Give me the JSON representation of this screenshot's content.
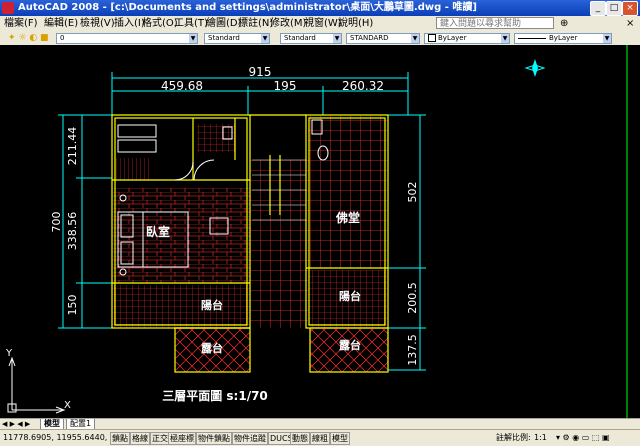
{
  "window": {
    "title": "AutoCAD 2008 - [c:\\Documents and settings\\administrator\\桌面\\大鵬草圖.dwg - 唯讀]"
  },
  "menu": {
    "items": [
      "檔案(F)",
      "編輯(E)",
      "檢視(V)",
      "插入(I)",
      "格式(O)",
      "工具(T)",
      "繪圖(D)",
      "標註(N)",
      "修改(M)",
      "視窗(W)",
      "說明(H)"
    ],
    "help_placeholder": "鍵入問題以尋求幫助"
  },
  "toolbar": {
    "layer_value": "0",
    "text_style": "Standard",
    "dim_style": "Standard",
    "table_style": "STANDARD",
    "color": "ByLayer",
    "linetype": "ByLayer"
  },
  "drawing": {
    "dim_top_total": "915",
    "dim_top_left": "459.68",
    "dim_top_mid": "195",
    "dim_top_right": "260.32",
    "dim_left_1": "211.44",
    "dim_left_2": "338.56",
    "dim_left_3": "150",
    "dim_left_total": "700",
    "dim_right_1": "502",
    "dim_right_2": "200.5",
    "dim_right_3": "137.5",
    "room_bedroom": "臥室",
    "room_buddha": "佛堂",
    "room_balcony_left": "陽台",
    "room_balcony_right": "陽台",
    "room_terrace_left": "露台",
    "room_terrace_right": "露台",
    "plan_title": "三層平面圖 s:1/70",
    "ucs_x": "X",
    "ucs_y": "Y"
  },
  "tabs": {
    "model": "模型",
    "layout": "配置1"
  },
  "status": {
    "coords": "11778.6905, 11955.6440, 0.0000",
    "buttons": [
      "鎖點",
      "格線",
      "正交",
      "極座標",
      "物件鎖點",
      "物件追蹤",
      "DUCS",
      "動態",
      "線粗",
      "模型"
    ],
    "annotation_scale_label": "註解比例:",
    "annotation_scale": "1:1"
  },
  "colors": {
    "title_bar": "#0a3fb8",
    "walls": "#ffff00",
    "dimension": "#00ffff",
    "hatch": "#ff3030",
    "furniture": "#ffffff",
    "line_green": "#00ff00"
  }
}
